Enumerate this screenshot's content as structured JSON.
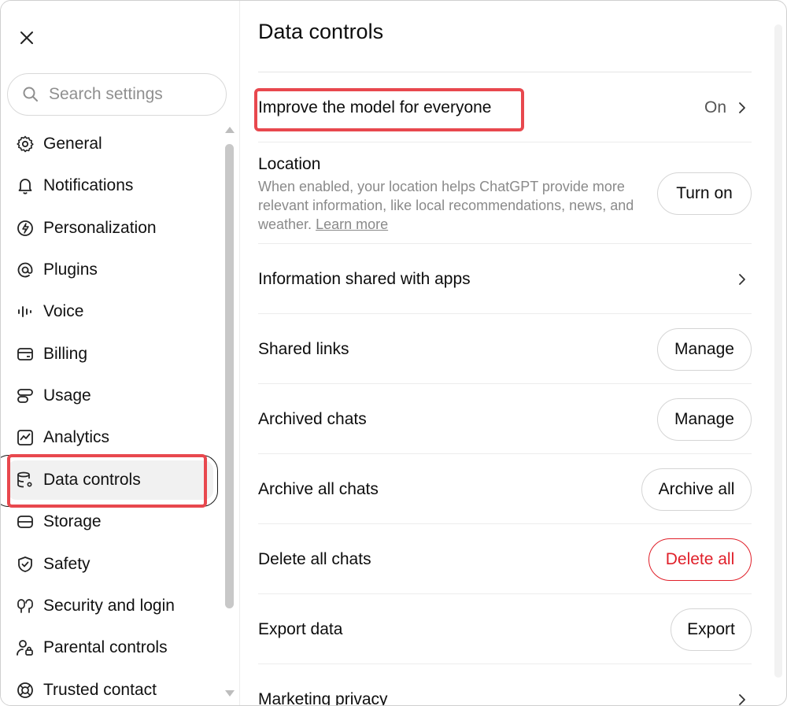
{
  "sidebar": {
    "search_placeholder": "Search settings",
    "items": [
      {
        "label": "General",
        "icon": "gear-icon"
      },
      {
        "label": "Notifications",
        "icon": "bell-icon"
      },
      {
        "label": "Personalization",
        "icon": "personalization-icon"
      },
      {
        "label": "Plugins",
        "icon": "at-sign-icon"
      },
      {
        "label": "Voice",
        "icon": "voice-waveform-icon"
      },
      {
        "label": "Billing",
        "icon": "credit-card-icon"
      },
      {
        "label": "Usage",
        "icon": "usage-icon"
      },
      {
        "label": "Analytics",
        "icon": "analytics-chart-icon"
      },
      {
        "label": "Data controls",
        "icon": "database-gear-icon",
        "active": true
      },
      {
        "label": "Storage",
        "icon": "storage-drive-icon"
      },
      {
        "label": "Safety",
        "icon": "shield-check-icon"
      },
      {
        "label": "Security and login",
        "icon": "security-login-icon"
      },
      {
        "label": "Parental controls",
        "icon": "parental-lock-icon"
      },
      {
        "label": "Trusted contact",
        "icon": "lifebuoy-icon"
      }
    ]
  },
  "main": {
    "title": "Data controls",
    "rows": {
      "improve": {
        "label": "Improve the model for everyone",
        "value": "On"
      },
      "location": {
        "label": "Location",
        "description": "When enabled, your location helps ChatGPT provide more relevant information, like local recommendations, news, and weather.",
        "learn_more": "Learn more",
        "button": "Turn on"
      },
      "info_apps": {
        "label": "Information shared with apps"
      },
      "shared_links": {
        "label": "Shared links",
        "button": "Manage"
      },
      "archived": {
        "label": "Archived chats",
        "button": "Manage"
      },
      "archive_all": {
        "label": "Archive all chats",
        "button": "Archive all"
      },
      "delete_all": {
        "label": "Delete all chats",
        "button": "Delete all"
      },
      "export": {
        "label": "Export data",
        "button": "Export"
      },
      "marketing": {
        "label": "Marketing privacy"
      }
    }
  },
  "colors": {
    "highlight_red": "#e8484e",
    "danger_red": "#e0202a",
    "active_bg": "#f1f1f1"
  }
}
